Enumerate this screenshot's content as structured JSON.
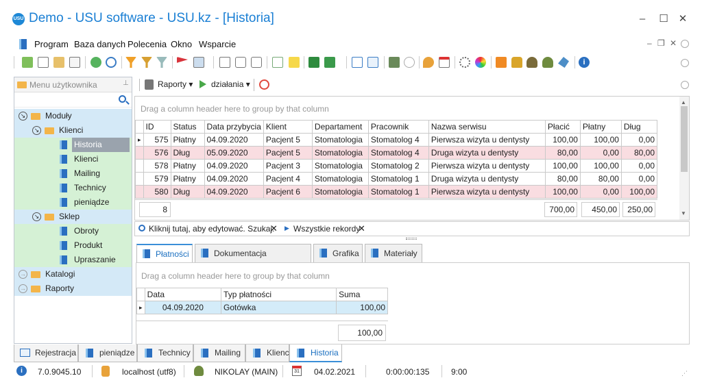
{
  "window": {
    "title": "Demo - USU software - USU.kz - [Historia]",
    "logo": "USU"
  },
  "menu": [
    "Program",
    "Baza danych",
    "Polecenia",
    "Okno",
    "Wsparcie"
  ],
  "sidebar": {
    "title": "Menu użytkownika",
    "tree": [
      {
        "label": "Moduły",
        "level": 0,
        "icon": "folder-open-icon",
        "expander": "collapse"
      },
      {
        "label": "Klienci",
        "level": 1,
        "icon": "folder-open-icon",
        "expander": "collapse"
      },
      {
        "label": "Historia",
        "level": 2,
        "icon": "book-icon",
        "selected": true
      },
      {
        "label": "Klienci",
        "level": 2,
        "icon": "book-icon"
      },
      {
        "label": "Mailing",
        "level": 2,
        "icon": "book-icon"
      },
      {
        "label": "Technicy",
        "level": 2,
        "icon": "book-icon"
      },
      {
        "label": "pieniądze",
        "level": 2,
        "icon": "book-icon"
      },
      {
        "label": "Sklep",
        "level": 1,
        "icon": "folder-open-icon",
        "expander": "collapse"
      },
      {
        "label": "Obroty",
        "level": 2,
        "icon": "book-icon"
      },
      {
        "label": "Produkt",
        "level": 2,
        "icon": "book-icon"
      },
      {
        "label": "Upraszanie",
        "level": 2,
        "icon": "book-icon"
      },
      {
        "label": "Katalogi",
        "level": 0,
        "icon": "folder-icon",
        "expander": "expand"
      },
      {
        "label": "Raporty",
        "level": 0,
        "icon": "folder-icon",
        "expander": "expand"
      }
    ]
  },
  "subtoolbar": {
    "reports": "Raporty",
    "actions": "działania"
  },
  "grid": {
    "group_hint": "Drag a column header here to group by that column",
    "columns": [
      "ID",
      "Status",
      "Data przybycia",
      "Klient",
      "Departament",
      "Pracownik",
      "Nazwa serwisu",
      "Płacić",
      "Płatny",
      "Dług"
    ],
    "rows": [
      {
        "cells": [
          "575",
          "Płatny",
          "04.09.2020",
          "Pacjent 5",
          "Stomatologia",
          "Stomatolog 4",
          "Pierwsza wizyta u dentysty",
          "100,00",
          "100,00",
          "0,00"
        ],
        "debt": false,
        "current": true
      },
      {
        "cells": [
          "576",
          "Dług",
          "05.09.2020",
          "Pacjent 5",
          "Stomatologia",
          "Stomatolog 4",
          "Druga wizyta u dentysty",
          "80,00",
          "0,00",
          "80,00"
        ],
        "debt": true
      },
      {
        "cells": [
          "578",
          "Płatny",
          "04.09.2020",
          "Pacjent 3",
          "Stomatologia",
          "Stomatolog 2",
          "Pierwsza wizyta u dentysty",
          "100,00",
          "100,00",
          "0,00"
        ],
        "debt": false
      },
      {
        "cells": [
          "579",
          "Płatny",
          "04.09.2020",
          "Pacjent 4",
          "Stomatologia",
          "Stomatolog 1",
          "Druga wizyta u dentysty",
          "80,00",
          "80,00",
          "0,00"
        ],
        "debt": false
      },
      {
        "cells": [
          "580",
          "Dług",
          "04.09.2020",
          "Pacjent 6",
          "Stomatologia",
          "Stomatolog 1",
          "Pierwsza wizyta u dentysty",
          "100,00",
          "0,00",
          "100,00"
        ],
        "debt": true
      }
    ],
    "footer": {
      "count": "8",
      "total_pay": "700,00",
      "total_paid": "450,00",
      "total_debt": "250,00"
    }
  },
  "findbar": {
    "text": "Kliknij tutaj, aby edytować. Szukaj:",
    "filter": "Wszystkie rekordy"
  },
  "detail_tabs": [
    "Płatności",
    "Dokumentacja dentystyczna",
    "Grafika",
    "Materiały"
  ],
  "detail": {
    "group_hint": "Drag a column header here to group by that column",
    "columns": [
      "Data",
      "Typ płatności",
      "Suma"
    ],
    "rows": [
      [
        "04.09.2020",
        "Gotówka",
        "100,00"
      ]
    ],
    "total": "100,00"
  },
  "bottom_tabs": [
    "Rejestracja",
    "pieniądze",
    "Technicy",
    "Mailing",
    "Klienci",
    "Historia"
  ],
  "status": {
    "version": "7.0.9045.10",
    "db": "localhost (utf8)",
    "user": "NIKOLAY (MAIN)",
    "calendar_day": "31",
    "date": "04.02.2021",
    "elapsed": "0:00:00:135",
    "time": "9:00"
  }
}
